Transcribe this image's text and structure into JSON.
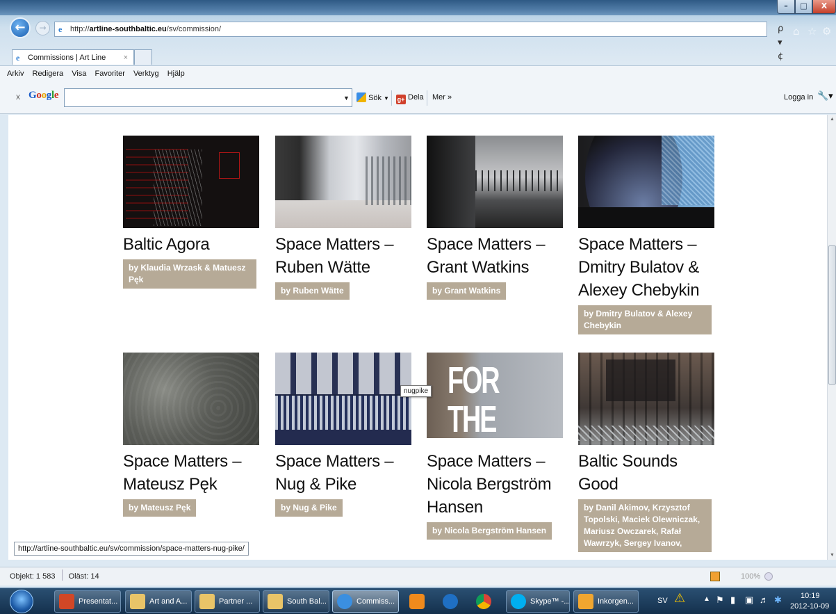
{
  "browser": {
    "url_prefix": "http://",
    "url_domain": "artline-southbaltic.eu",
    "url_path": "/sv/commission/",
    "tab_title": "Commissions | Art Line",
    "tab_close": "×",
    "window_buttons": {
      "minimize": "–",
      "maximize": "□",
      "close": "X"
    },
    "address_tools": "ρ ▾ ¢ ×"
  },
  "menu": [
    "Arkiv",
    "Redigera",
    "Visa",
    "Favoriter",
    "Verktyg",
    "Hjälp"
  ],
  "google_toolbar": {
    "close": "x",
    "logo": "Google",
    "search_value": "",
    "sok": "Sök",
    "dela": "Dela",
    "mer": "Mer »",
    "login": "Logga in"
  },
  "commissions": [
    {
      "title": "Baltic Agora",
      "by": "by Klaudia Wrzask & Matuesz Pęk"
    },
    {
      "title": "Space Matters – Ruben Wätte",
      "by": "by Ruben Wätte"
    },
    {
      "title": "Space Matters – Grant Watkins",
      "by": "by Grant Watkins"
    },
    {
      "title": "Space Matters – Dmitry Bulatov & Alexey Chebykin",
      "by": "by Dmitry Bulatov & Alexey Chebykin"
    },
    {
      "title": "Space Matters – Mateusz Pęk",
      "by": "by Mateusz Pęk"
    },
    {
      "title": "Space Matters – Nug & Pike",
      "by": "by Nug & Pike"
    },
    {
      "title": "Space Matters – Nicola Bergström Hansen",
      "by": "by Nicola Bergström Hansen"
    },
    {
      "title": "Baltic Sounds Good",
      "by": "by Danil Akimov, Krzysztof Topolski, Maciek Olewniczak, Mariusz Owczarek, Rafał Wawrzyk, Sergey Ivanov,"
    }
  ],
  "thumb_text": {
    "nicola": "FOR THE"
  },
  "tooltip": "nugpike",
  "status": {
    "hover_link": "http://artline-southbaltic.eu/sv/commission/space-matters-nug-pike/",
    "objekt": "Objekt: 1 583",
    "olast": "Oläst: 14",
    "zoom": "100%"
  },
  "taskbar": {
    "items": [
      "Presentat...",
      "Art and A...",
      "Partner ...",
      "South Bal...",
      "Commiss...",
      "Skype™ -...",
      "Inkorgen..."
    ],
    "language": "SV",
    "time": "10:19",
    "date": "2012-10-09"
  },
  "colors": {
    "byline_bg": "#b6aa97",
    "taskbar": "#1d3b5c"
  }
}
